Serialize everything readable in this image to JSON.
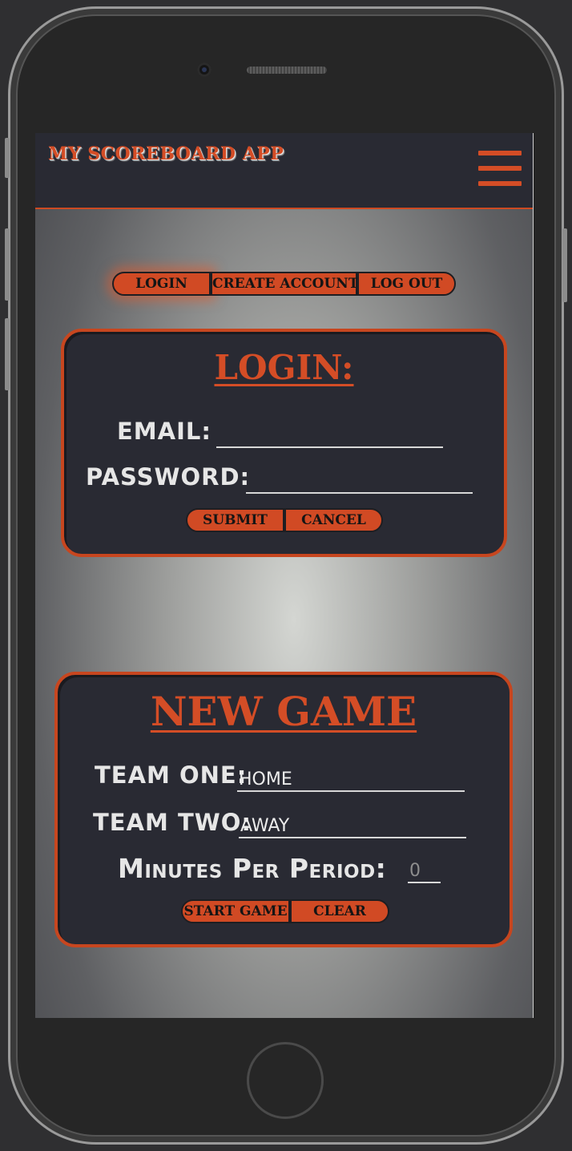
{
  "header": {
    "title": "MY SCOREBOARD APP",
    "menu_icon": "hamburger-menu-icon"
  },
  "nav": {
    "login": "LOGIN",
    "create_account": "CREATE ACCOUNT",
    "log_out": "LOG OUT"
  },
  "login_card": {
    "title": "LOGIN:",
    "email_label": "EMAIL:",
    "email_value": "",
    "password_label": "PASSWORD:",
    "password_value": "",
    "submit": "SUBMIT",
    "cancel": "CANCEL"
  },
  "new_game_card": {
    "title": "NEW GAME",
    "team_one_label": "TEAM ONE:",
    "team_one_value": "HOME",
    "team_two_label": "TEAM TWO:",
    "team_two_value": "AWAY",
    "minutes_label": "Minutes Per Period:",
    "minutes_placeholder": "0",
    "start_game": "START GAME",
    "clear": "CLEAR"
  },
  "colors": {
    "accent": "#d14a24",
    "panel": "#292a33",
    "text": "#e6e6e6"
  }
}
